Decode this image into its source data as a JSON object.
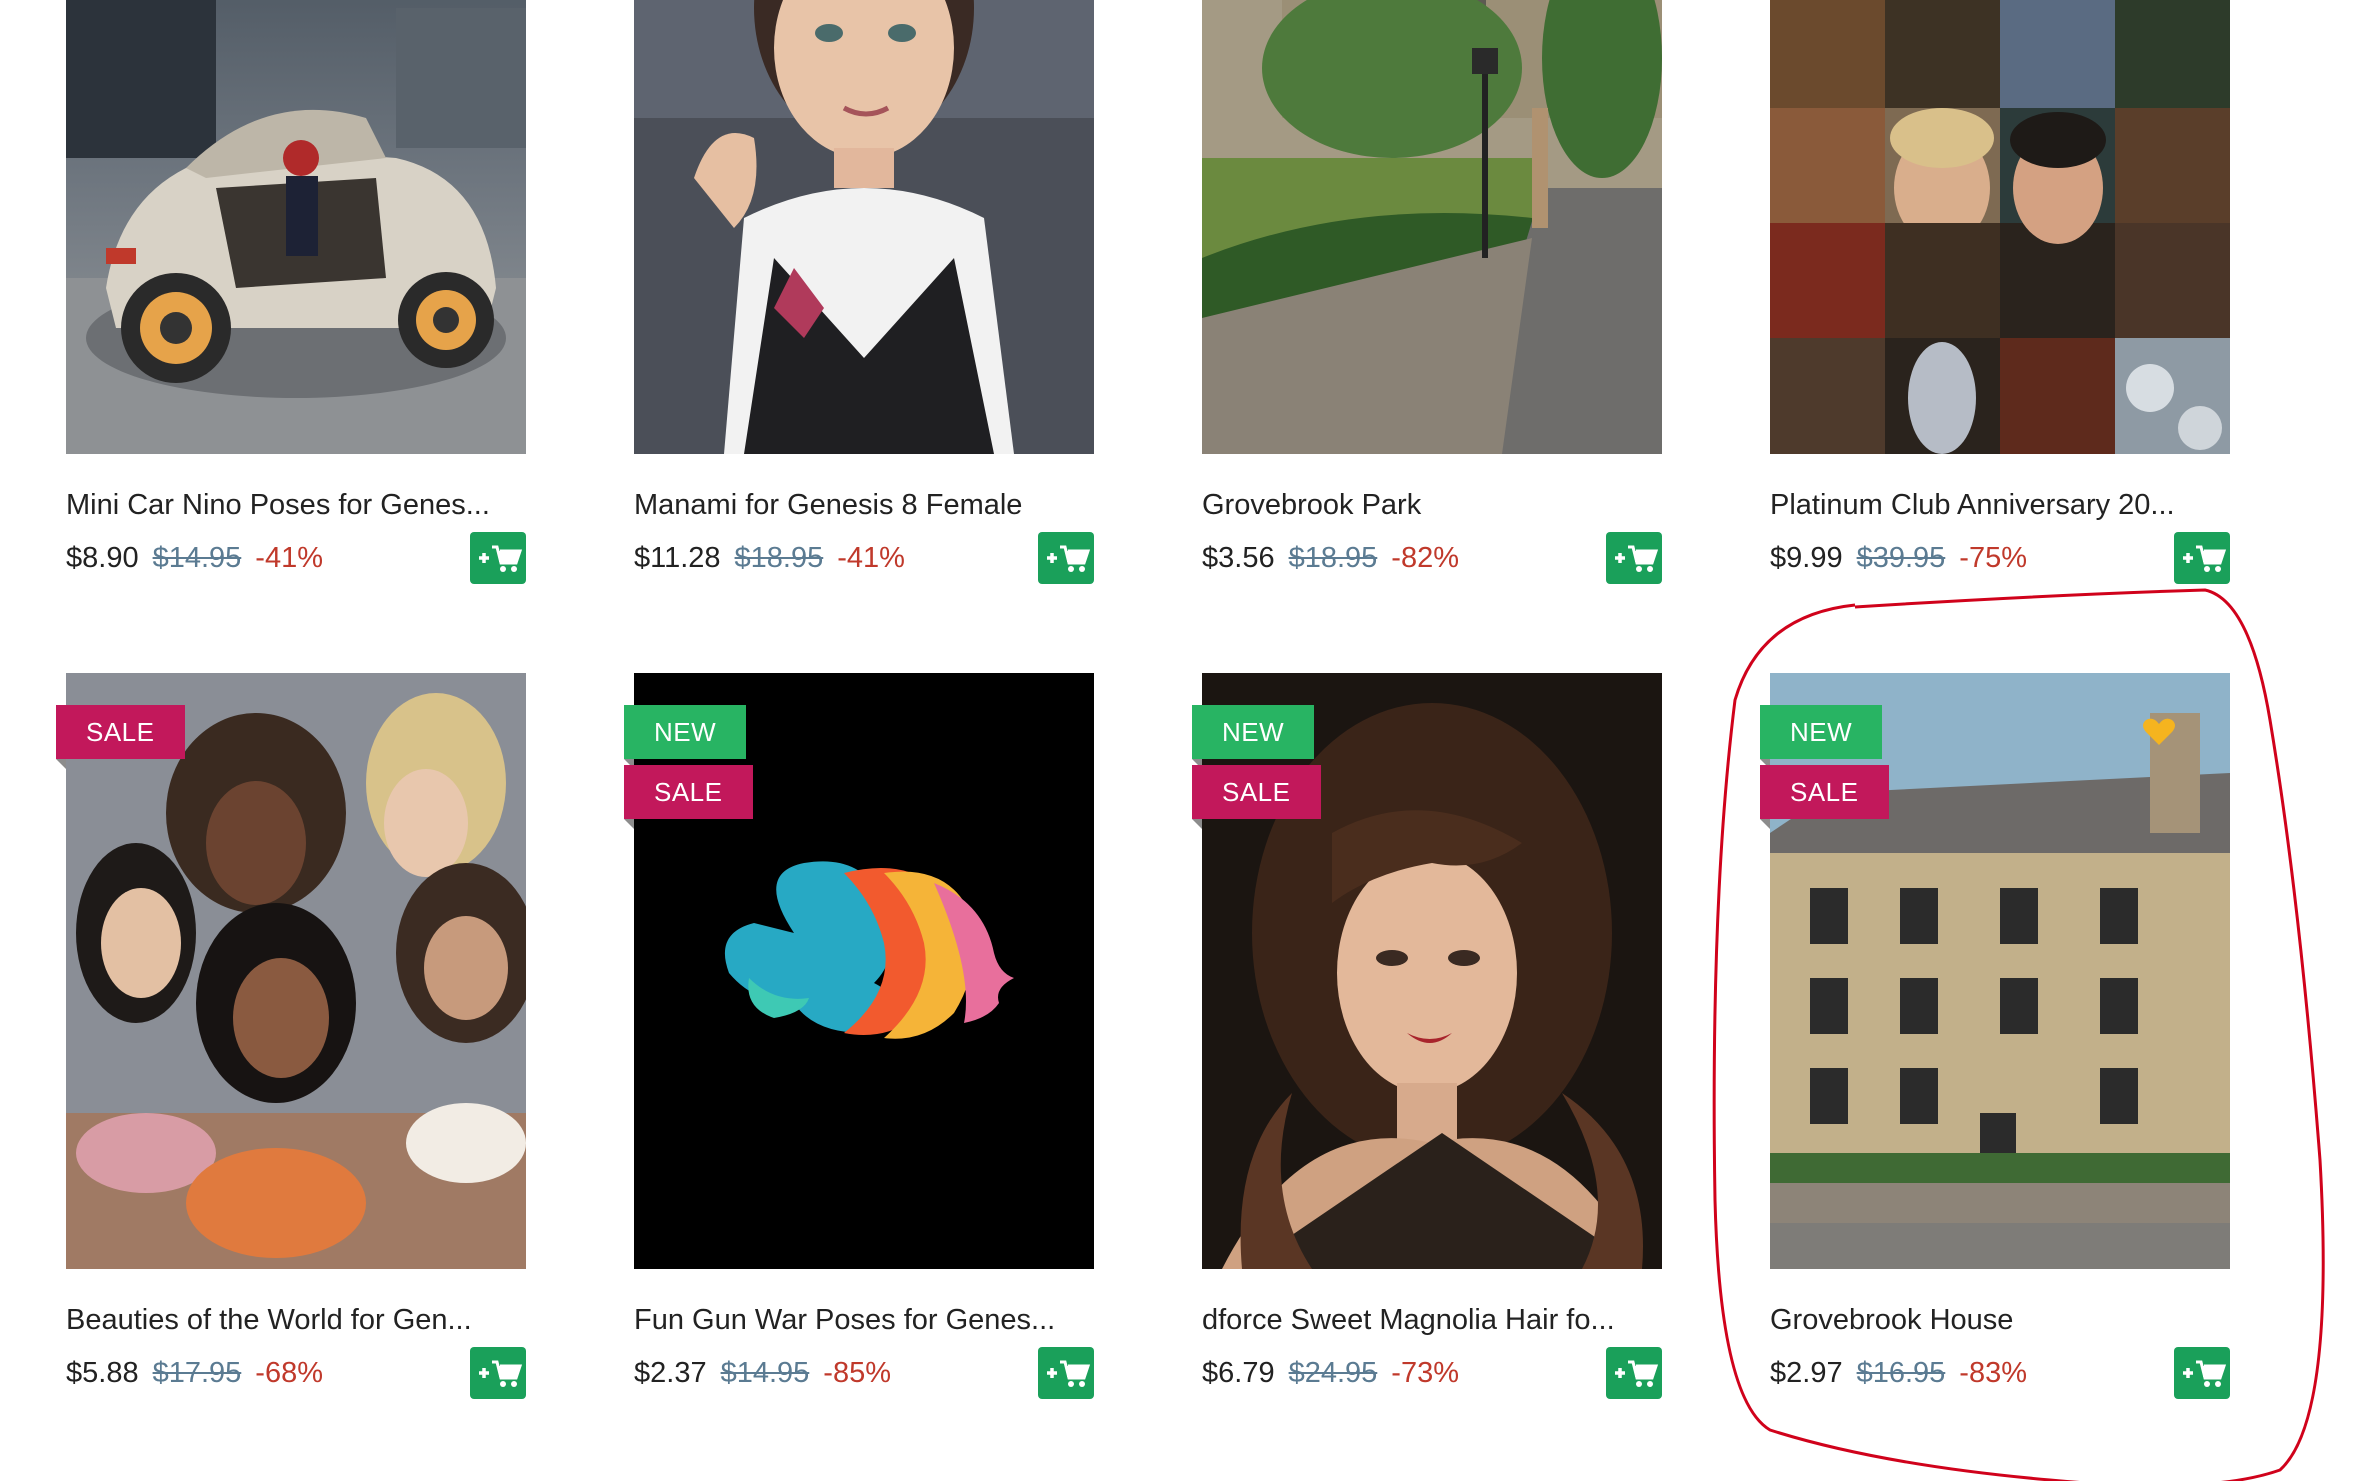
{
  "colors": {
    "new_badge": "#28b463",
    "sale_badge": "#c2185b",
    "cart_button": "#1aa05a",
    "discount": "#c0392b",
    "old_price": "#5b7b92",
    "annotation": "#d0021b"
  },
  "products": [
    {
      "title": "Mini Car Nino Poses for Genes...",
      "price": "$8.90",
      "old_price": "$14.95",
      "discount": "-41%",
      "badges": []
    },
    {
      "title": "Manami for Genesis 8 Female",
      "price": "$11.28",
      "old_price": "$18.95",
      "discount": "-41%",
      "badges": []
    },
    {
      "title": "Grovebrook Park",
      "price": "$3.56",
      "old_price": "$18.95",
      "discount": "-82%",
      "badges": []
    },
    {
      "title": "Platinum Club Anniversary 20...",
      "price": "$9.99",
      "old_price": "$39.95",
      "discount": "-75%",
      "badges": []
    },
    {
      "title": "Beauties of the World for Gen...",
      "price": "$5.88",
      "old_price": "$17.95",
      "discount": "-68%",
      "badges": [
        "SALE"
      ]
    },
    {
      "title": "Fun Gun War Poses for Genes...",
      "price": "$2.37",
      "old_price": "$14.95",
      "discount": "-85%",
      "badges": [
        "NEW",
        "SALE"
      ]
    },
    {
      "title": "dforce Sweet Magnolia Hair fo...",
      "price": "$6.79",
      "old_price": "$24.95",
      "discount": "-73%",
      "badges": [
        "NEW",
        "SALE"
      ]
    },
    {
      "title": "Grovebrook House",
      "price": "$2.97",
      "old_price": "$16.95",
      "discount": "-83%",
      "badges": [
        "NEW",
        "SALE"
      ],
      "wishlisted": true
    }
  ],
  "labels": {
    "new": "NEW",
    "sale": "SALE"
  },
  "icons": {
    "cart": "add-to-cart-icon",
    "favorite": "heart-icon"
  }
}
